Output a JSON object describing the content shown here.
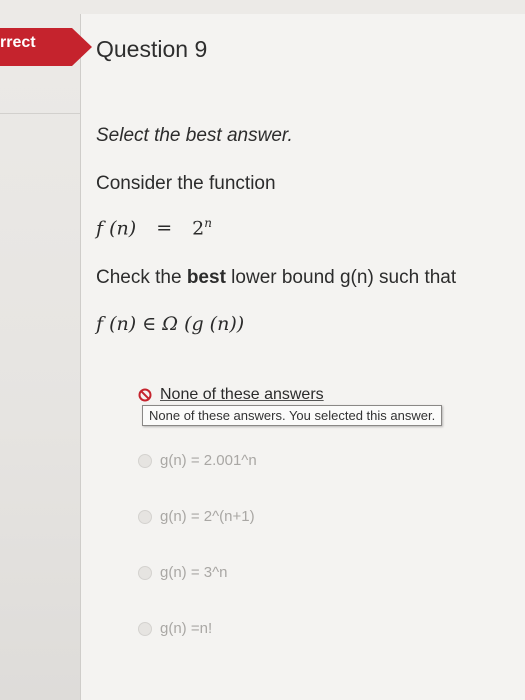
{
  "status": {
    "label": "rrect"
  },
  "question": {
    "title": "Question 9",
    "instruction": "Select the best answer.",
    "intro": "Consider the function",
    "function_lhs": "f (n)",
    "function_eq": "=",
    "function_rhs_base": "2",
    "function_rhs_exp": "n",
    "bound_pre": "Check the ",
    "bound_bold": "best",
    "bound_post": " lower bound g(n) such that",
    "membership": "f (n) ∈ Ω (g (n))"
  },
  "answers": {
    "selected": {
      "label": "None of these answers",
      "tooltip": "None of these answers. You selected this answer."
    },
    "options": [
      {
        "label": "g(n) = 2.001^n"
      },
      {
        "label": "g(n) = 2^(n+1)"
      },
      {
        "label": "g(n) = 3^n"
      },
      {
        "label": "g(n) =n!"
      }
    ]
  },
  "colors": {
    "ribbon": "#c5232d",
    "incorrect_icon": "#c5232d"
  }
}
